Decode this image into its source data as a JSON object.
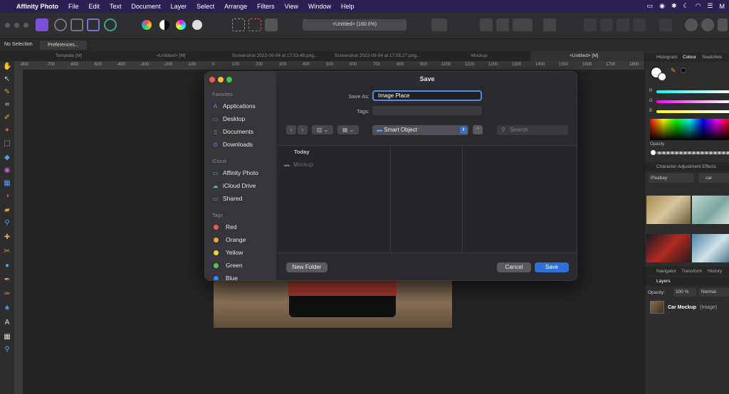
{
  "menubar": {
    "apple": "",
    "app": "Affinity Photo",
    "items": [
      "File",
      "Edit",
      "Text",
      "Document",
      "Layer",
      "Select",
      "Arrange",
      "Filters",
      "View",
      "Window",
      "Help"
    ],
    "user": "M"
  },
  "toolbar": {
    "doc_title": "<Untitled> (160.0%)"
  },
  "context": {
    "no_selection": "No Selection",
    "preferences": "Preferences..."
  },
  "tabs": [
    "Template [M]",
    "<Untitled> [M]",
    "Screenshot 2022-09-04 at 17.53.48.png...",
    "Screenshot 2022-09-04 at 17.55.27.png...",
    "Mockup",
    "<Untitled> [M]"
  ],
  "ruler": [
    "-900",
    "-700",
    "-600",
    "-500",
    "-400",
    "-300",
    "-200",
    "-100",
    "0",
    "100",
    "200",
    "300",
    "400",
    "500",
    "600",
    "700",
    "800",
    "900",
    "1000",
    "1100",
    "1200",
    "1300",
    "1400",
    "1500",
    "1600",
    "1700",
    "1800"
  ],
  "dialog": {
    "title": "Save",
    "sidebar": {
      "favorites_header": "Favorites",
      "favorites": [
        {
          "icon": "A",
          "label": "Applications"
        },
        {
          "icon": "▭",
          "label": "Desktop"
        },
        {
          "icon": "▯",
          "label": "Documents"
        },
        {
          "icon": "⊙",
          "label": "Downloads"
        }
      ],
      "icloud_header": "iCloud",
      "icloud": [
        {
          "icon": "▭",
          "label": "Affinity Photo"
        },
        {
          "icon": "☁",
          "label": "iCloud Drive"
        },
        {
          "icon": "▭",
          "label": "Shared"
        }
      ],
      "tags_header": "Tags",
      "tags": [
        {
          "color": "#ec5b56",
          "label": "Red"
        },
        {
          "color": "#f1a03a",
          "label": "Orange"
        },
        {
          "color": "#f5d23a",
          "label": "Yellow"
        },
        {
          "color": "#5ec25a",
          "label": "Green"
        },
        {
          "color": "#3b82f6",
          "label": "Blue"
        }
      ]
    },
    "save_as_label": "Save As:",
    "save_as_value": "Image Place",
    "tags_label": "Tags:",
    "location": "Smart Object",
    "search_placeholder": "Search",
    "section_today": "Today",
    "file_item": "Mockup",
    "new_folder": "New Folder",
    "cancel": "Cancel",
    "save": "Save"
  },
  "panel": {
    "tabs_top": [
      "Histogram",
      "Colour",
      "Swatches"
    ],
    "rgb": [
      "R",
      "G",
      "B"
    ],
    "opacity_label": "Opacity",
    "tabs_mid": "Character  Adjustment  Effects",
    "stock_source": "Pixabay",
    "stock_query": "car",
    "tabs_nav": [
      "Navigator",
      "Transform",
      "History"
    ],
    "layers_tab": "Layers",
    "layer_opacity_label": "Opacity:",
    "layer_opacity_value": "100 %",
    "blend_mode": "Normal",
    "layer_name": "Car Mockup",
    "layer_type": "(Image)"
  },
  "colors": {
    "accent": "#4a8fe8",
    "menubar": "#2c1f52",
    "save_button": "#2f6fd6"
  }
}
